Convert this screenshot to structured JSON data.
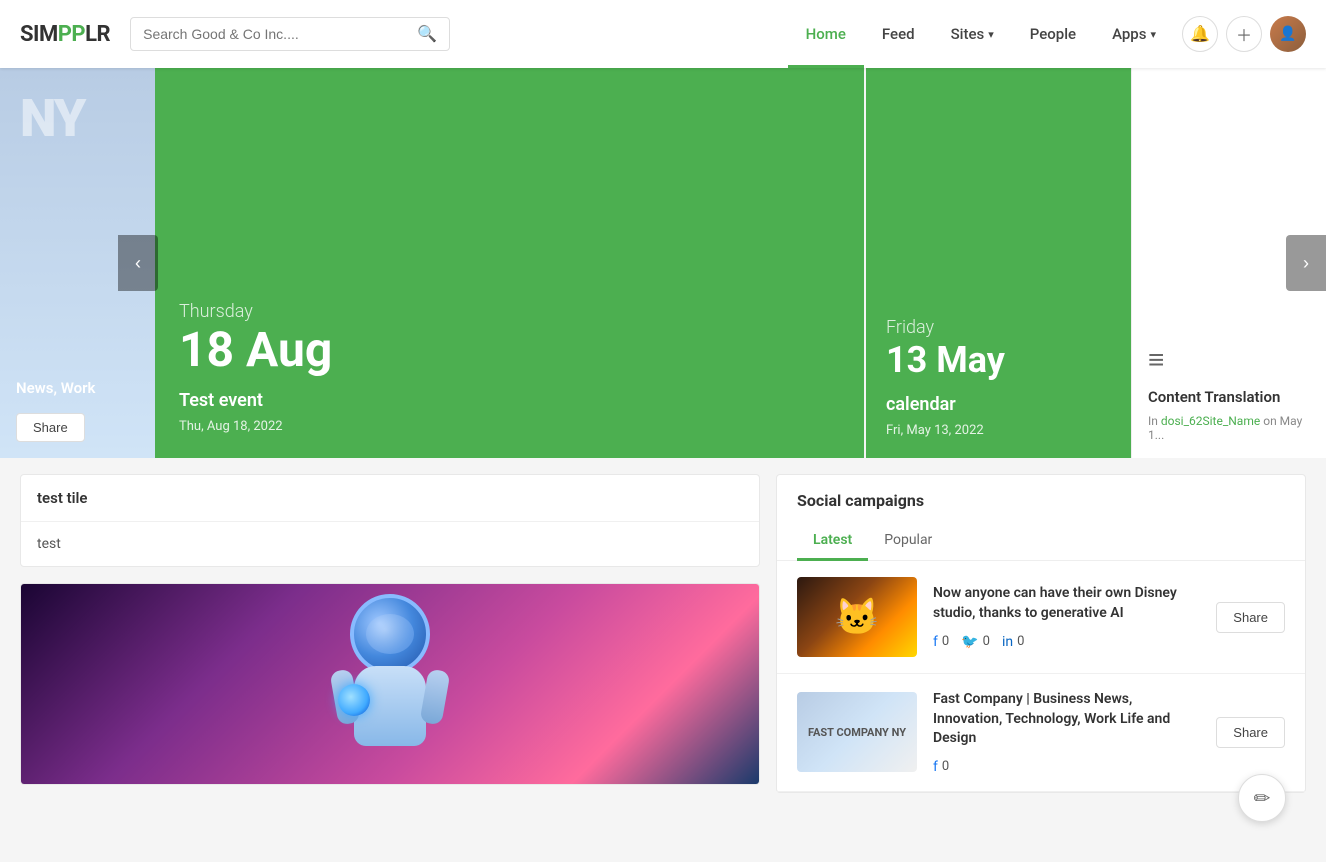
{
  "header": {
    "logo": "SIMPPLR",
    "search_placeholder": "Search Good & Co Inc....",
    "nav_items": [
      {
        "label": "Home",
        "active": true
      },
      {
        "label": "Feed",
        "active": false
      },
      {
        "label": "Sites",
        "has_dropdown": true,
        "active": false
      },
      {
        "label": "People",
        "active": false
      },
      {
        "label": "Apps",
        "has_dropdown": true,
        "active": false
      }
    ]
  },
  "carousel": {
    "prev_btn": "‹",
    "next_btn": "›",
    "card_small": {
      "initials": "NY",
      "title": "News, Work",
      "share_label": "Share"
    },
    "card_green_large": {
      "day": "Thursday",
      "date": "18 Aug",
      "event_name": "Test event",
      "date_text": "Thu, Aug 18, 2022"
    },
    "card_green_small": {
      "day": "Friday",
      "date": "13 May",
      "event_name": "calendar",
      "date_text": "Fri, May 13, 2022"
    },
    "card_right": {
      "title": "Content Translation",
      "meta_prefix": "In",
      "meta_link": "dosi_62Site_Name",
      "meta_suffix": "on May 1..."
    }
  },
  "test_tile": {
    "title": "test tile",
    "body": "test"
  },
  "social_campaigns": {
    "title": "Social campaigns",
    "tabs": [
      {
        "label": "Latest",
        "active": true
      },
      {
        "label": "Popular",
        "active": false
      }
    ],
    "items": [
      {
        "title": "Now anyone can have their own Disney studio, thanks to generative AI",
        "fb_count": "0",
        "tw_count": "0",
        "li_count": "0",
        "share_label": "Share",
        "thumb_type": "disney"
      },
      {
        "title": "Fast Company | Business News, Innovation, Technology, Work Life and Design",
        "fb_count": "0",
        "tw_count": null,
        "li_count": null,
        "share_label": "Share",
        "thumb_type": "fastco",
        "thumb_text": "FAST COMPANY NY"
      }
    ]
  },
  "fab_icon": "✏"
}
